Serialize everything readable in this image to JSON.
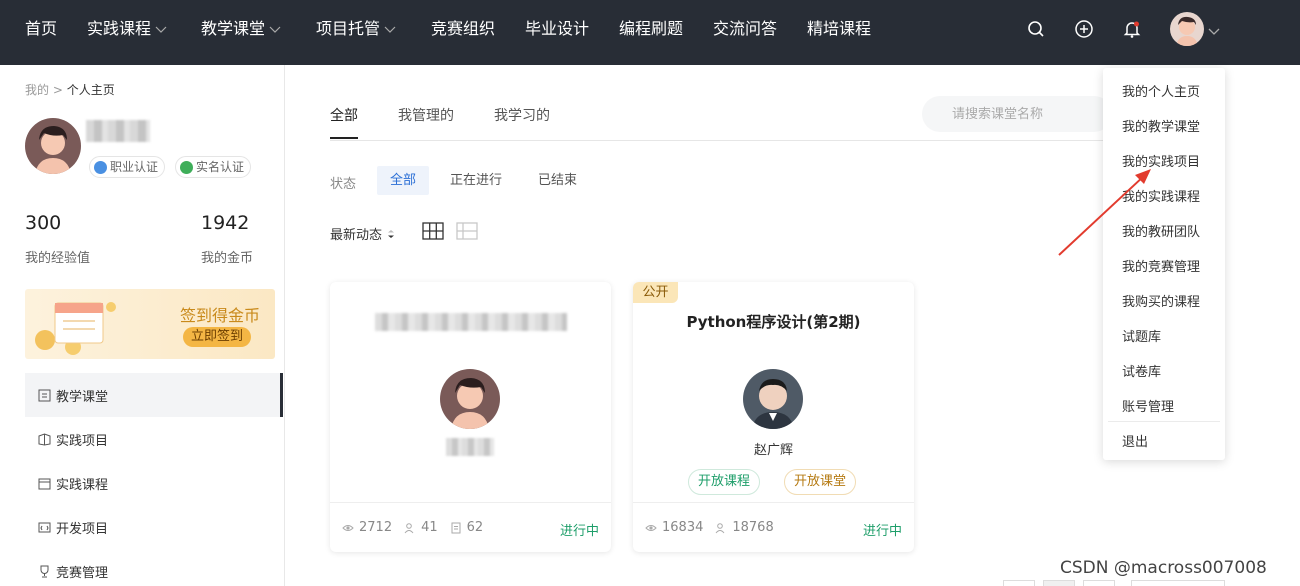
{
  "nav": {
    "items": [
      {
        "label": "首页",
        "has_dropdown": false
      },
      {
        "label": "实践课程",
        "has_dropdown": true
      },
      {
        "label": "教学课堂",
        "has_dropdown": true
      },
      {
        "label": "项目托管",
        "has_dropdown": true
      },
      {
        "label": "竞赛组织",
        "has_dropdown": false
      },
      {
        "label": "毕业设计",
        "has_dropdown": false
      },
      {
        "label": "编程刷题",
        "has_dropdown": false
      },
      {
        "label": "交流问答",
        "has_dropdown": false
      },
      {
        "label": "精培课程",
        "has_dropdown": false
      }
    ],
    "icons": [
      "search-icon",
      "plus-circle-icon",
      "bell-icon",
      "avatar",
      "chevron-down-icon"
    ]
  },
  "sidebar": {
    "breadcrumb": {
      "parent": "我的",
      "sep": ">",
      "current": "个人主页"
    },
    "badges": [
      "职业认证",
      "实名认证"
    ],
    "stats": [
      {
        "value": "300",
        "label": "我的经验值"
      },
      {
        "value": "1942",
        "label": "我的金币"
      }
    ],
    "signin": {
      "title": "签到得金币",
      "button": "立即签到"
    },
    "menu": [
      {
        "label": "教学课堂",
        "active": true,
        "icon": "classroom-icon"
      },
      {
        "label": "实践项目",
        "active": false,
        "icon": "project-icon"
      },
      {
        "label": "实践课程",
        "active": false,
        "icon": "course-icon"
      },
      {
        "label": "开发项目",
        "active": false,
        "icon": "dev-project-icon"
      },
      {
        "label": "竞赛管理",
        "active": false,
        "icon": "trophy-icon"
      }
    ]
  },
  "main": {
    "tabs": [
      {
        "label": "全部",
        "active": true
      },
      {
        "label": "我管理的",
        "active": false
      },
      {
        "label": "我学习的",
        "active": false
      }
    ],
    "search": {
      "placeholder": "请搜索课堂名称"
    },
    "filter": {
      "label": "状态",
      "options": [
        {
          "label": "全部",
          "active": true
        },
        {
          "label": "正在进行",
          "active": false
        },
        {
          "label": "已结束",
          "active": false
        }
      ]
    },
    "sort": {
      "label": "最新动态"
    },
    "cards": [
      {
        "title": "",
        "teacher": "",
        "public": false,
        "tags": [],
        "stats": {
          "views": "2712",
          "members": "41",
          "docs": "62"
        },
        "status": "进行中"
      },
      {
        "title": "Python程序设计(第2期)",
        "teacher": "赵广辉",
        "public": true,
        "public_label": "公开",
        "tags": [
          {
            "label": "开放课程",
            "color": "#1e9e6a"
          },
          {
            "label": "开放课堂",
            "color": "#c98a1b"
          }
        ],
        "stats": {
          "views": "16834",
          "members": "18768"
        },
        "status": "进行中"
      }
    ]
  },
  "dropdown": {
    "items": [
      "我的个人主页",
      "我的教学课堂",
      "我的实践项目",
      "我的实践课程",
      "我的教研团队",
      "我的竞赛管理",
      "我购买的课程",
      "试题库",
      "试卷库",
      "账号管理"
    ],
    "logout": "退出"
  },
  "watermark": "CSDN @macross007008",
  "colors": {
    "nav_bg": "#282d36",
    "accent": "#2b6fd6",
    "status_green": "#1e9e6a",
    "annotation_red": "#e23b2e"
  }
}
